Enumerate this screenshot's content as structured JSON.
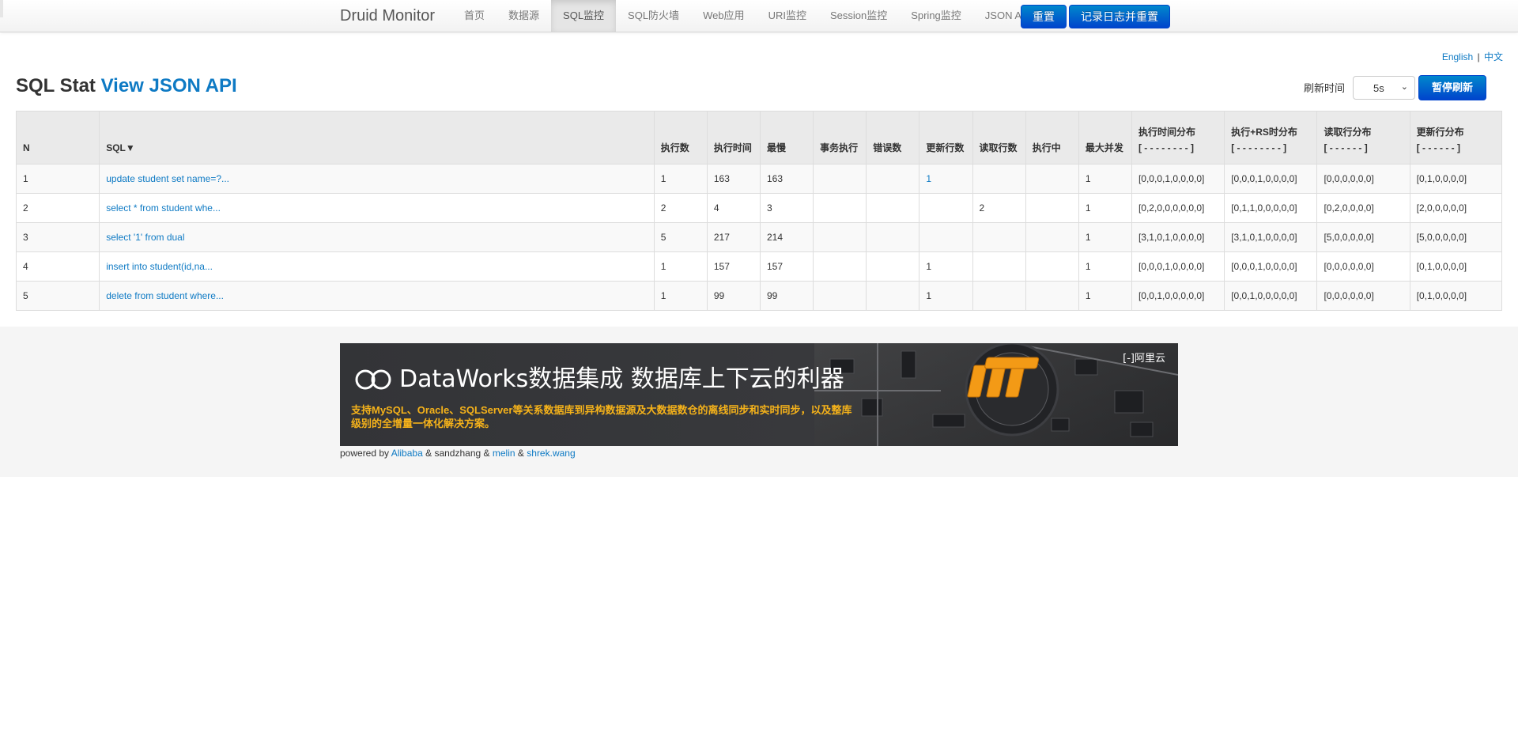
{
  "nav": {
    "brand": "Druid Monitor",
    "items": [
      {
        "label": "首页"
      },
      {
        "label": "数据源"
      },
      {
        "label": "SQL监控",
        "active": true
      },
      {
        "label": "SQL防火墙"
      },
      {
        "label": "Web应用"
      },
      {
        "label": "URI监控"
      },
      {
        "label": "Session监控"
      },
      {
        "label": "Spring监控"
      },
      {
        "label": "JSON API"
      }
    ],
    "reset_label": "重置",
    "log_reset_label": "记录日志并重置"
  },
  "lang": {
    "english": "English",
    "sep": "|",
    "chinese": "中文"
  },
  "title": {
    "prefix": "SQL Stat",
    "link": "View JSON API"
  },
  "refresh": {
    "label": "刷新时间",
    "selected": "5s",
    "pause_label": "暂停刷新"
  },
  "table": {
    "headers": {
      "n": "N",
      "sql": "SQL▼",
      "exec_count": "执行数",
      "exec_time": "执行时间",
      "slowest": "最慢",
      "tx_exec": "事务执行",
      "errors": "错误数",
      "update_rows": "更新行数",
      "read_rows": "读取行数",
      "running": "执行中",
      "max_concurrent": "最大并发",
      "exec_hist": "执行时间分布",
      "exec_hist_sub": "[ - - - - - - - - ]",
      "exec_rs_hist": "执行+RS时分布",
      "exec_rs_hist_sub": "[ - - - - - - - - ]",
      "read_hist": "读取行分布",
      "read_hist_sub": "[ - - - - - - ]",
      "update_hist": "更新行分布",
      "update_hist_sub": "[ - - - - - - ]"
    },
    "rows": [
      {
        "n": "1",
        "sql": "update student set name=?...",
        "exec_count": "1",
        "exec_time": "163",
        "slowest": "163",
        "tx_exec": "",
        "errors": "",
        "update_rows": "1",
        "read_rows": "",
        "running": "",
        "max_concurrent": "1",
        "exec_hist": "[0,0,0,1,0,0,0,0]",
        "exec_rs_hist": "[0,0,0,1,0,0,0,0]",
        "read_hist": "[0,0,0,0,0,0]",
        "update_hist": "[0,1,0,0,0,0]"
      },
      {
        "n": "2",
        "sql": "select * from student whe...",
        "exec_count": "2",
        "exec_time": "4",
        "slowest": "3",
        "tx_exec": "",
        "errors": "",
        "update_rows": "",
        "read_rows": "2",
        "running": "",
        "max_concurrent": "1",
        "exec_hist": "[0,2,0,0,0,0,0,0]",
        "exec_rs_hist": "[0,1,1,0,0,0,0,0]",
        "read_hist": "[0,2,0,0,0,0]",
        "update_hist": "[2,0,0,0,0,0]"
      },
      {
        "n": "3",
        "sql": "select '1' from dual",
        "exec_count": "5",
        "exec_time": "217",
        "slowest": "214",
        "tx_exec": "",
        "errors": "",
        "update_rows": "",
        "read_rows": "",
        "running": "",
        "max_concurrent": "1",
        "exec_hist": "[3,1,0,1,0,0,0,0]",
        "exec_rs_hist": "[3,1,0,1,0,0,0,0]",
        "read_hist": "[5,0,0,0,0,0]",
        "update_hist": "[5,0,0,0,0,0]"
      },
      {
        "n": "4",
        "sql": "insert into student(id,na...",
        "exec_count": "1",
        "exec_time": "157",
        "slowest": "157",
        "tx_exec": "",
        "errors": "",
        "update_rows": "1",
        "read_rows": "",
        "running": "",
        "max_concurrent": "1",
        "exec_hist": "[0,0,0,1,0,0,0,0]",
        "exec_rs_hist": "[0,0,0,1,0,0,0,0]",
        "read_hist": "[0,0,0,0,0,0]",
        "update_hist": "[0,1,0,0,0,0]"
      },
      {
        "n": "5",
        "sql": "delete from student where...",
        "exec_count": "1",
        "exec_time": "99",
        "slowest": "99",
        "tx_exec": "",
        "errors": "",
        "update_rows": "1",
        "read_rows": "",
        "running": "",
        "max_concurrent": "1",
        "exec_hist": "[0,0,1,0,0,0,0,0]",
        "exec_rs_hist": "[0,0,1,0,0,0,0,0]",
        "read_hist": "[0,0,0,0,0,0]",
        "update_hist": "[0,1,0,0,0,0]"
      }
    ]
  },
  "banner": {
    "headline": "DataWorks数据集成 数据库上下云的利器",
    "subline": "支持MySQL、Oracle、SQLServer等关系数据库到异构数据源及大数据数仓的离线同步和实时同步，以及整库级别的全增量一体化解决方案。",
    "brand": "阿里云",
    "brand_mark": "[-]",
    "accent_color": "#f5b21a"
  },
  "footer": {
    "powered_by": "powered by",
    "alibaba": "Alibaba",
    "amp1": "&",
    "sandzhang": "sandzhang",
    "amp2": "&",
    "melin": "melin",
    "amp3": "&",
    "shrek": "shrek.wang"
  },
  "colors": {
    "primary": "#0044cc",
    "link": "#0e7ac4",
    "table_header": "#eaeaea"
  }
}
